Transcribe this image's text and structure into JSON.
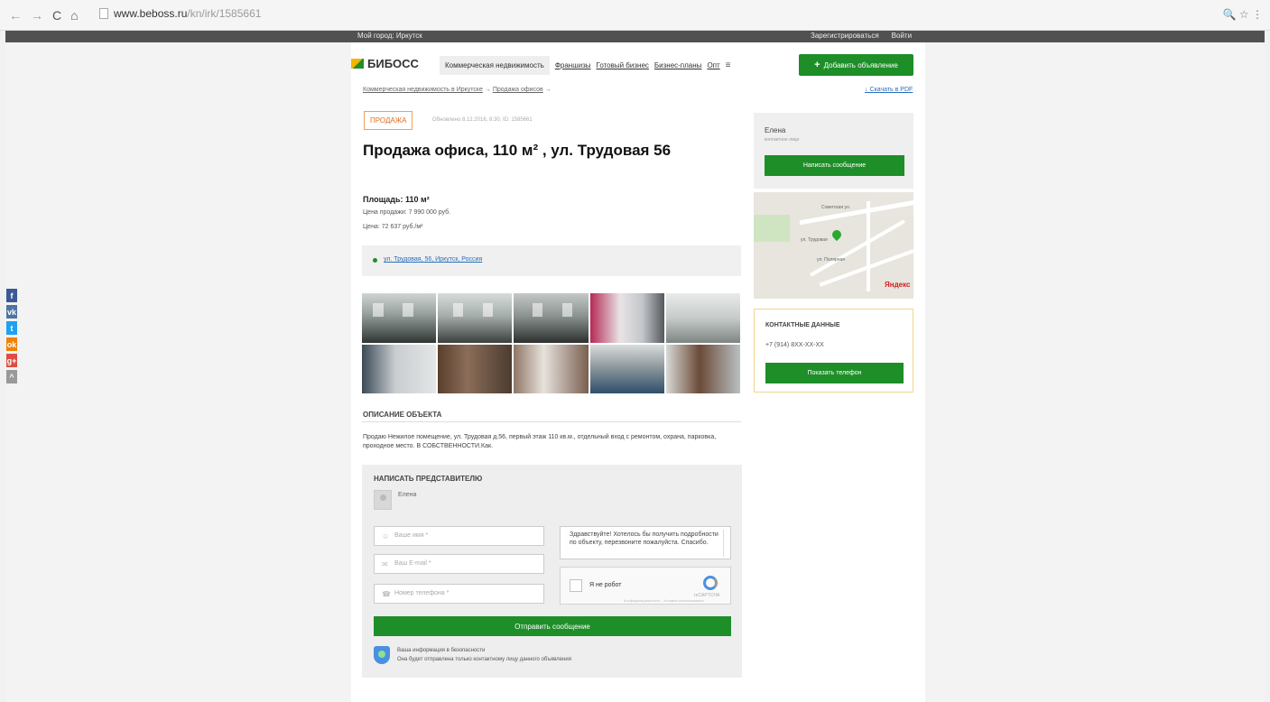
{
  "browser": {
    "url_host": "www.beboss.ru",
    "url_path": "/kn/irk/1585661",
    "nav_back": "←",
    "nav_forward": "→",
    "reload": "C",
    "home": "⌂",
    "right_icons": "🔍 ☆ ⋮"
  },
  "topbar": {
    "city": "Мой город: Иркутск",
    "register": "Зарегистрироваться",
    "login": "Войти"
  },
  "header": {
    "logo": "БИБОСС",
    "menu": [
      "Коммерческая недвижимость",
      "Франшизы",
      "Готовый бизнес",
      "Бизнес-планы",
      "Опт"
    ],
    "more": "≡",
    "add_button": "Добавить объявление",
    "add_plus": "+"
  },
  "breadcrumbs": {
    "item1": "Коммерческая недвижимость в Иркутске",
    "sep": "→",
    "item2": "Продажа офисов",
    "arrow": "→",
    "pdf": "↓ Скачать в PDF"
  },
  "listing": {
    "badge": "ПРОДАЖА",
    "published": "Обновлено 8.12.2016, 8:30, ID: 1585661",
    "title": "Продажа офиса, 110 м² , ул. Трудовая 56",
    "area": "Площадь: 110 м²",
    "price": "Цена продажи: 7 990 000 руб.",
    "price_per_m2": "Цена: 72 637 руб./м²",
    "address": "ул. Трудовая, 56, Иркутск, Россия"
  },
  "description": {
    "heading": "ОПИСАНИЕ ОБЪЕКТА",
    "text": "Продаю Нежилое помещение, ул. Трудовая д.56, первый этаж 110 кв.м., отдельный вход с ремонтом, охрана, парковка, проходное место. В СОБСТВЕННОСТИ.Как."
  },
  "form": {
    "heading": "НАПИСАТЬ ПРЕДСТАВИТЕЛЮ",
    "rep_name": "Елена",
    "name_placeholder": "Ваше имя *",
    "email_placeholder": "Ваш E-mail *",
    "phone_placeholder": "Номер телефона *",
    "message": "Здравствуйте! Хотелось бы получить подробности по объекту, перезвоните пожалуйста. Спасибо.",
    "captcha_label": "Я не робот",
    "captcha_brand": "reCAPTCHA",
    "captcha_small": "Конфиденциальность - Условия использования",
    "send_button": "Отправить сообщение",
    "security_line1": "Ваша информация в безопасности",
    "security_line2": "Она будет отправлена только контактному лицу данного объявления"
  },
  "seller": {
    "name": "Елена",
    "role": "контактное лицо",
    "message_button": "Написать сообщение"
  },
  "map": {
    "street1": "Советская ул.",
    "street2": "ул. Трудовая",
    "street3": "ул. Полярная",
    "brand": "Яндекс"
  },
  "contacts": {
    "heading": "КОНТАКТНЫЕ ДАННЫЕ",
    "phone": "+7 (914) 8XX-XX-XX",
    "show_button": "Показать телефон"
  },
  "social": [
    "f",
    "vk",
    "t",
    "ok",
    "g+",
    "^"
  ]
}
